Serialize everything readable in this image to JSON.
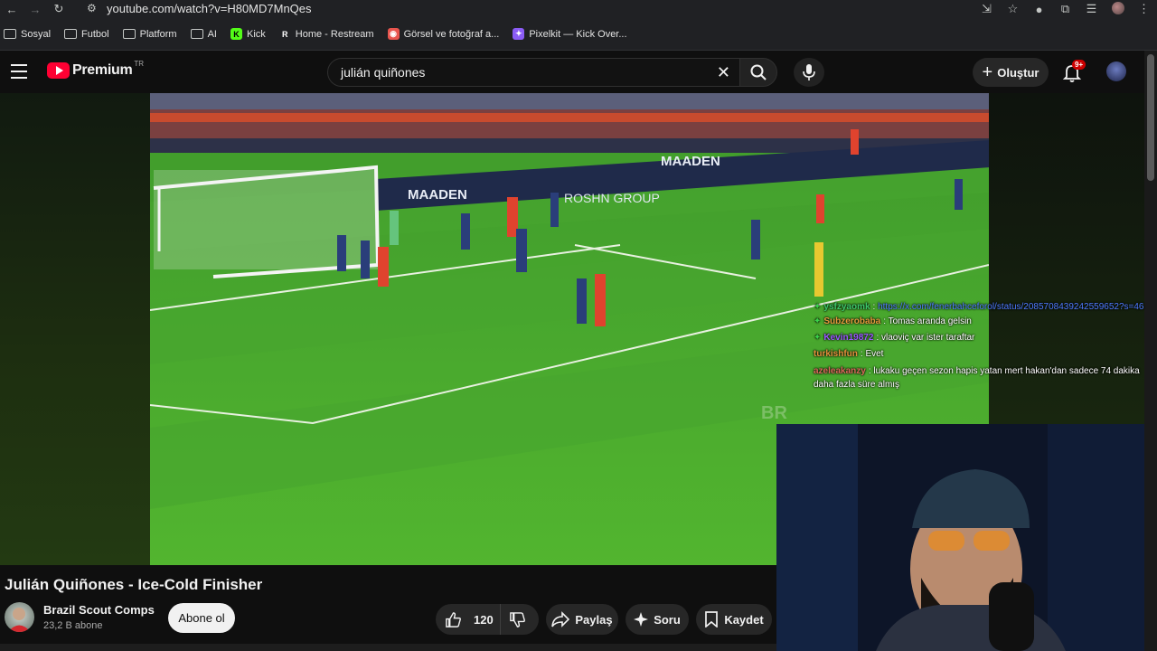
{
  "browser": {
    "url": "youtube.com/watch?v=H80MD7MnQes",
    "bookmarks": [
      {
        "label": "Sosyal",
        "kind": "folder"
      },
      {
        "label": "Futbol",
        "kind": "folder"
      },
      {
        "label": "Platform",
        "kind": "folder"
      },
      {
        "label": "AI",
        "kind": "folder"
      },
      {
        "label": "Kick",
        "kind": "site",
        "color": "#53fc18",
        "glyph": "K"
      },
      {
        "label": "Home - Restream",
        "kind": "site",
        "color": "#202124",
        "glyph": "R"
      },
      {
        "label": "Görsel ve fotoğraf a...",
        "kind": "site",
        "color": "#e8554e",
        "glyph": "◉"
      },
      {
        "label": "Pixelkit — Kick Over...",
        "kind": "site",
        "color": "#8b5cf6",
        "glyph": "✦"
      }
    ]
  },
  "youtube": {
    "logo_text": "Premium",
    "region": "TR",
    "search_value": "julián quiñones",
    "create_label": "Oluştur",
    "notifications_badge": "9+",
    "accent": "#ff0033"
  },
  "chat": [
    {
      "user": "ysfzyaomk",
      "user_color": "#3ec96b",
      "message": "https://x.com/fenerbahceforol/status/2085708439242559652?s=46",
      "is_link": true,
      "badge": true
    },
    {
      "user": "Subzerobaba",
      "user_color": "#e59a3c",
      "message": "Tomas aranda gelsin",
      "badge": true
    },
    {
      "user": "Kevin19872",
      "user_color": "#9b59ff",
      "message": "vlaoviç var ister taraftar",
      "badge": true
    },
    {
      "user": "turkishfun",
      "user_color": "#e5913c",
      "message": "Evet",
      "badge": false
    },
    {
      "user": "azeleakanzy",
      "user_color": "#d96a5a",
      "message": "lukaku geçen sezon hapis yatan mert hakan'dan sadece 74 dakika daha fazla süre almış",
      "badge": false
    }
  ],
  "video": {
    "title": "Julián Quiñones - Ice-Cold Finisher",
    "channel": "Brazil Scout Comps",
    "subscribers": "23,2 B abone",
    "subscribe_label": "Abone ol",
    "likes": "120",
    "share_label": "Paylaş",
    "ask_label": "Soru",
    "save_label": "Kaydet",
    "overlay_text": {
      "ad1": "MAADEN",
      "ad2": "ROSHN GROUP",
      "ad3": "MAADEN",
      "watermark": "BR"
    }
  }
}
